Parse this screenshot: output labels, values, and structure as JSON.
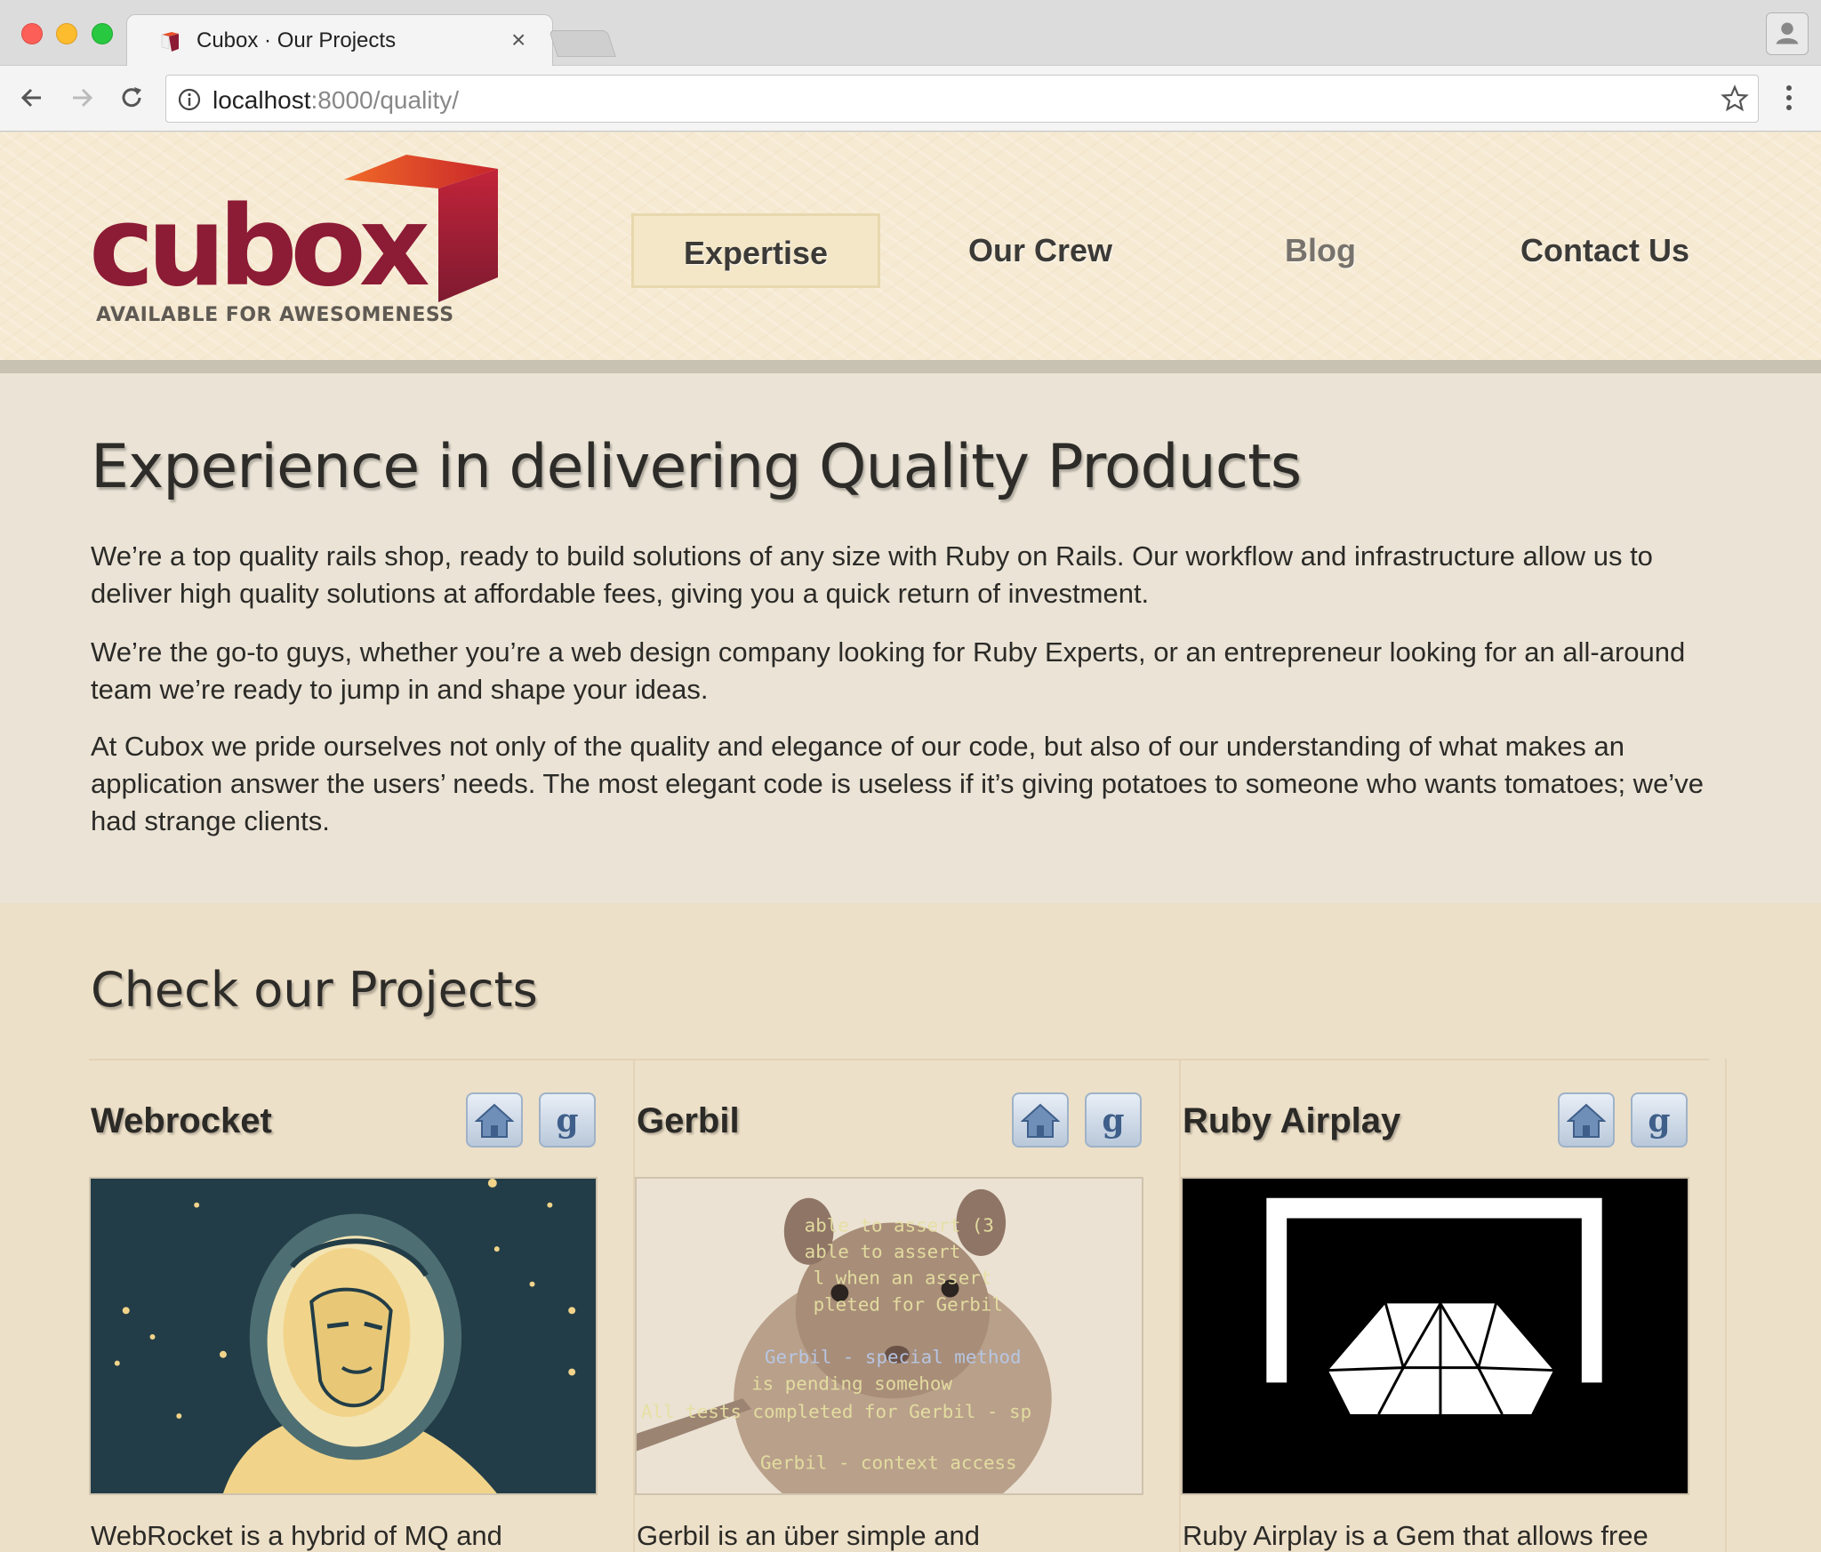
{
  "browser": {
    "tab_title": "Cubox · Our Projects",
    "close_symbol": "×",
    "url_host": "localhost",
    "url_rest": ":8000/quality/"
  },
  "header": {
    "logo_word": "cubox",
    "tagline": "AVAILABLE FOR AWESOMENESS",
    "brand_color": "#8c1b35",
    "nav": [
      {
        "label": "Expertise",
        "state": "active"
      },
      {
        "label": "Our Crew",
        "state": "normal"
      },
      {
        "label": "Blog",
        "state": "muted"
      },
      {
        "label": "Contact Us",
        "state": "normal"
      }
    ]
  },
  "intro": {
    "title": "Experience in delivering Quality Products",
    "paragraphs": [
      "We’re a top quality rails shop, ready to build solutions of any size with Ruby on Rails. Our workflow and infrastructure allow us to deliver high quality solutions at affordable fees, giving you a quick return of investment.",
      "We’re the go-to guys, whether you’re a web design company looking for Ruby Experts, or an entrepreneur looking for an all-around team we’re ready to jump in and shape your ideas.",
      "At Cubox we pride ourselves not only of the quality and elegance of our code, but also of our understanding of what makes an application answer the users’ needs. The most elegant code is useless if it’s giving potatoes to someone who wants tomatoes; we’ve had strange clients."
    ]
  },
  "projects": {
    "title": "Check our Projects",
    "items": [
      {
        "name": "Webrocket",
        "image": "astronaut-illustration",
        "description": "WebRocket is a hybrid of MQ and"
      },
      {
        "name": "Gerbil",
        "image": "gerbil-photo",
        "description": "Gerbil is an über simple and"
      },
      {
        "name": "Ruby Airplay",
        "image": "airplay-ruby-logo",
        "description": "Ruby Airplay is a Gem that allows free"
      }
    ],
    "gerbil_overlay_lines": [
      "able to assert (3",
      "able to assert",
      "l when an assert",
      "pleted for Gerbil",
      "Gerbil - special method",
      "is pending somehow",
      "All tests completed for Gerbil - sp",
      "Gerbil - context access"
    ]
  },
  "icons": [
    "back-arrow-icon",
    "forward-arrow-icon",
    "reload-icon",
    "info-icon",
    "star-icon",
    "menu-dots-icon",
    "profile-icon",
    "home-icon",
    "github-icon"
  ]
}
